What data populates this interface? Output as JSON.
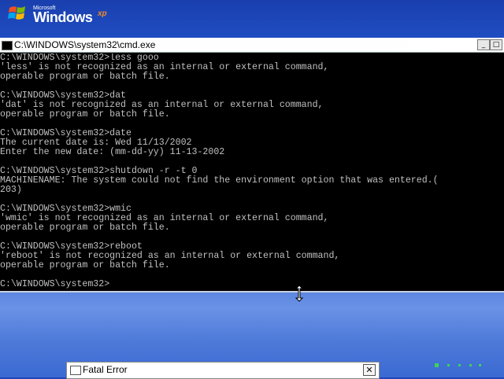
{
  "desktop": {
    "logo": {
      "microsoft": "Microsoft",
      "windows": "Windows",
      "xp": "xp"
    }
  },
  "cmd": {
    "title": "C:\\WINDOWS\\system32\\cmd.exe",
    "buttons": {
      "minimize": "_",
      "maximize": "□"
    },
    "lines": [
      "C:\\WINDOWS\\system32>less gooo",
      "'less' is not recognized as an internal or external command,",
      "operable program or batch file.",
      "",
      "C:\\WINDOWS\\system32>dat",
      "'dat' is not recognized as an internal or external command,",
      "operable program or batch file.",
      "",
      "C:\\WINDOWS\\system32>date",
      "The current date is: Wed 11/13/2002",
      "Enter the new date: (mm-dd-yy) 11-13-2002",
      "",
      "C:\\WINDOWS\\system32>shutdown -r -t 0",
      "MACHINENAME: The system could not find the environment option that was entered.(",
      "203)",
      "",
      "C:\\WINDOWS\\system32>wmic",
      "'wmic' is not recognized as an internal or external command,",
      "operable program or batch file.",
      "",
      "C:\\WINDOWS\\system32>reboot",
      "'reboot' is not recognized as an internal or external command,",
      "operable program or batch file.",
      "",
      "C:\\WINDOWS\\system32>"
    ]
  },
  "dialog": {
    "title": "Fatal Error",
    "close": "✕"
  },
  "icons": {
    "cmd": "console-icon",
    "dialog": "window-icon",
    "cursor": "resize-vertical-cursor-icon"
  },
  "colors": {
    "desktop_blue": "#2a5bd0",
    "console_text": "#c0c0c0",
    "console_bg": "#000000",
    "progress_green": "#3ed15a",
    "xp_orange": "#f28a2a"
  }
}
